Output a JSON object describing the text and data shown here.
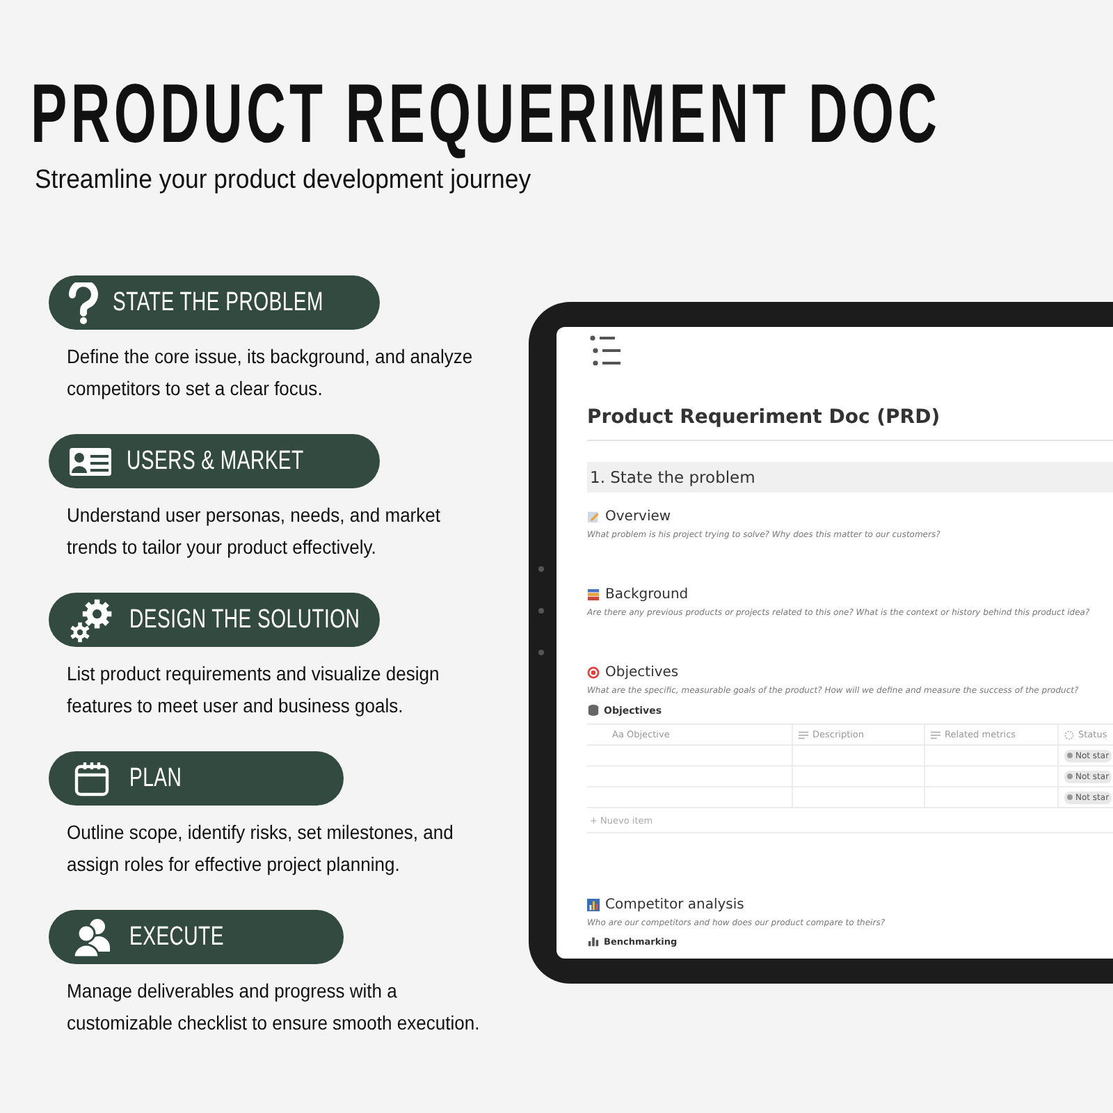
{
  "title": "PRODUCT REQUERIMENT DOC",
  "subtitle": "Streamline your product development journey",
  "features": [
    {
      "kind": "question",
      "label": "STATE THE PROBLEM",
      "text": "Define the core issue, its background, and analyze competitors to set a clear focus."
    },
    {
      "kind": "id-card",
      "label": "USERS & MARKET",
      "text": "Understand user personas, needs, and market trends to tailor your product effectively."
    },
    {
      "kind": "gears",
      "label": "DESIGN THE SOLUTION",
      "text": "List product requirements and visualize design features to meet user and business goals."
    },
    {
      "kind": "calendar",
      "label": "PLAN",
      "text": "Outline scope, identify risks, set milestones, and assign roles for effective project planning."
    },
    {
      "kind": "people",
      "label": "EXECUTE",
      "text": "Manage deliverables and progress with a customizable checklist to ensure smooth execution."
    }
  ],
  "doc": {
    "title": "Product Requeriment Doc (PRD)",
    "section": "1. State the problem",
    "blocks": [
      {
        "title": "Overview",
        "hint": "What problem is his project trying to solve? Why does this matter to our customers?"
      },
      {
        "title": "Background",
        "hint": "Are there any previous products or projects related to this one? What is the context or history behind this product idea?"
      },
      {
        "title": "Objectives",
        "hint": "What are the specific, measurable goals of the product? How will we define and measure the success of the product?",
        "table": {
          "name": "Objectives",
          "columns": [
            {
              "kind": "name",
              "label": "Aa Objective"
            },
            {
              "kind": "text",
              "label": "Description"
            },
            {
              "kind": "text",
              "label": "Related metrics"
            },
            {
              "kind": "status",
              "label": "Status"
            }
          ],
          "rows": [
            {
              "status": "Not star"
            },
            {
              "status": "Not star"
            },
            {
              "status": "Not star"
            }
          ],
          "new_item": "+ Nuevo item"
        }
      },
      {
        "title": "Competitor analysis",
        "hint": "Who are our competitors and how does our product compare to theirs?",
        "view": "Benchmarking"
      }
    ]
  }
}
